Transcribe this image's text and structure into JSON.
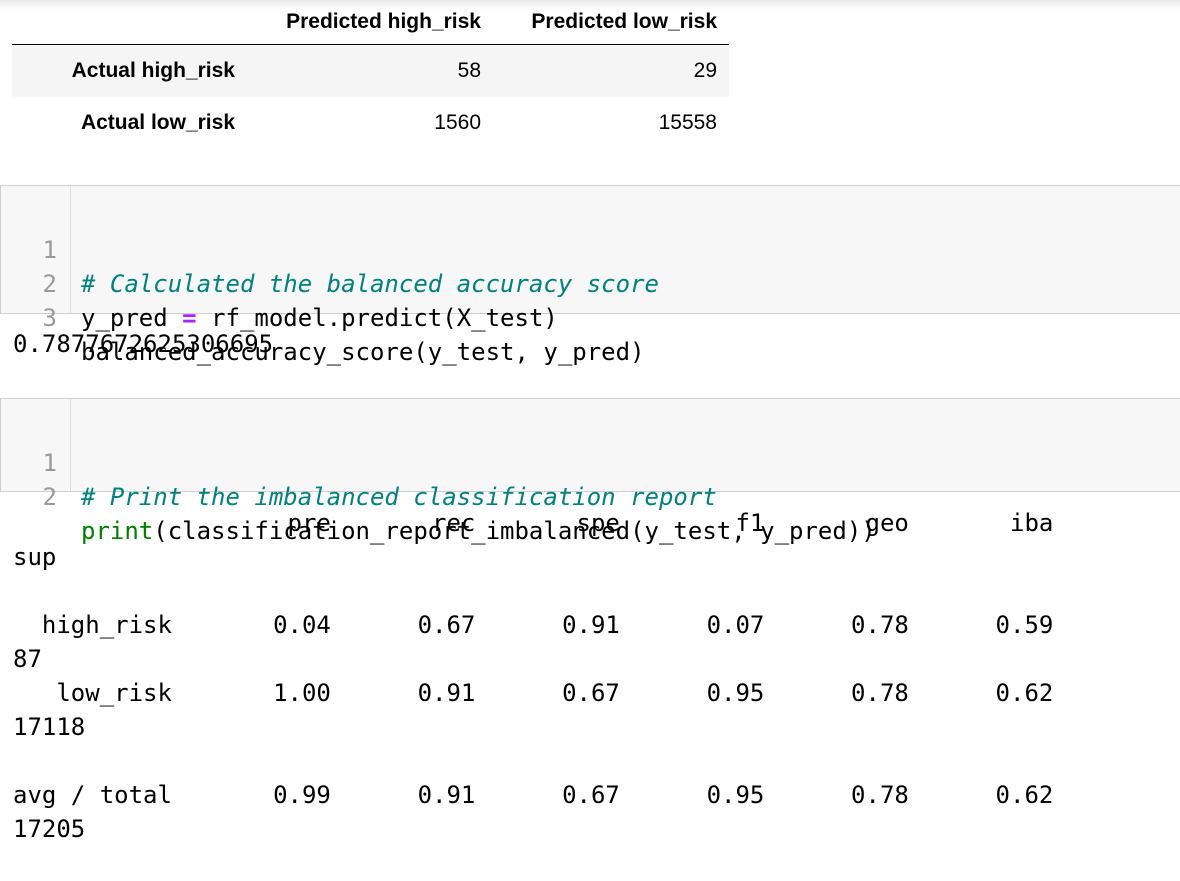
{
  "confusion_matrix": {
    "columns": [
      "Predicted high_risk",
      "Predicted low_risk"
    ],
    "rows": [
      {
        "label": "Actual high_risk",
        "values": [
          "58",
          "29"
        ]
      },
      {
        "label": "Actual low_risk",
        "values": [
          "1560",
          "15558"
        ]
      }
    ]
  },
  "cell1": {
    "line_numbers": [
      "1",
      "2",
      "3"
    ],
    "line1": "# Calculated the balanced accuracy score",
    "line2_a": "y_pred ",
    "line2_op": "=",
    "line2_b": " rf_model.predict(X_test)",
    "line3": "balanced_accuracy_score(y_test, y_pred)"
  },
  "output1": "0.7877672625306695",
  "cell2": {
    "line_numbers": [
      "1",
      "2"
    ],
    "line1": "# Print the imbalanced classification report",
    "line2_fn": "print",
    "line2_rest": "(classification_report_imbalanced(y_test, y_pred))"
  },
  "report": {
    "header_line": "                   pre       rec       spe        f1       geo       iba",
    "header_wrap": "sup",
    "rows": [
      {
        "line": "  high_risk       0.04      0.67      0.91      0.07      0.78      0.59",
        "wrap": "87"
      },
      {
        "line": "   low_risk       1.00      0.91      0.67      0.95      0.78      0.62",
        "wrap": "17118"
      },
      {
        "line": "avg / total       0.99      0.91      0.67      0.95      0.78      0.62",
        "wrap": "17205"
      }
    ]
  }
}
